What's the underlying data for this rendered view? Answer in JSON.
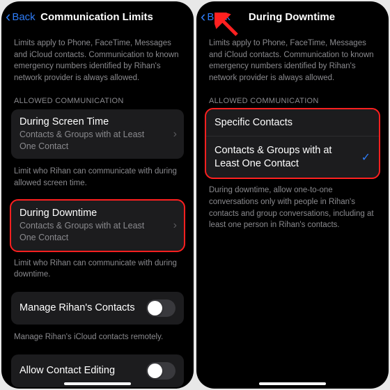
{
  "left": {
    "nav": {
      "back": "Back",
      "title": "Communication Limits"
    },
    "intro": "Limits apply to Phone, FaceTime, Messages and iCloud contacts. Communication to known emergency numbers identified by Rihan's network provider is always allowed.",
    "allowed_header": "ALLOWED COMMUNICATION",
    "screen_time": {
      "title": "During Screen Time",
      "sub": "Contacts & Groups with at Least One Contact"
    },
    "screen_time_footer": "Limit who Rihan can communicate with during allowed screen time.",
    "downtime": {
      "title": "During Downtime",
      "sub": "Contacts & Groups with at Least One Contact"
    },
    "downtime_footer": "Limit who Rihan can communicate with during downtime.",
    "manage": "Manage Rihan's Contacts",
    "manage_footer": "Manage Rihan's iCloud contacts remotely.",
    "allow_edit": "Allow Contact Editing"
  },
  "right": {
    "nav": {
      "back": "Back",
      "title": "During Downtime"
    },
    "intro": "Limits apply to Phone, FaceTime, Messages and iCloud contacts. Communication to known emergency numbers identified by Rihan's network provider is always allowed.",
    "allowed_header": "ALLOWED COMMUNICATION",
    "opt1": "Specific Contacts",
    "opt2": "Contacts & Groups with at Least One Contact",
    "footer": "During downtime, allow one-to-one conversations only with people in Rihan's contacts and group conversations, including at least one person in Rihan's contacts."
  }
}
